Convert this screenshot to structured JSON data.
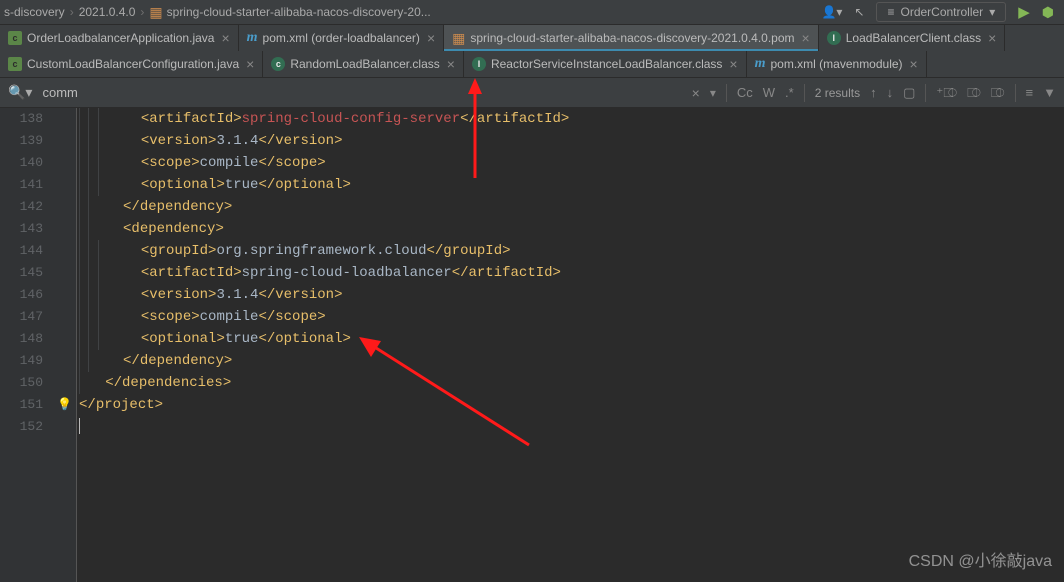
{
  "breadcrumb": {
    "b1": "s-discovery",
    "b2": "2021.0.4.0",
    "b3": "spring-cloud-starter-alibaba-nacos-discovery-20..."
  },
  "run_config": "OrderController",
  "tabs": {
    "t1": "OrderLoadbalancerApplication.java",
    "t2": "pom.xml (order-loadbalancer)",
    "t3": "spring-cloud-starter-alibaba-nacos-discovery-2021.0.4.0.pom",
    "t4": "LoadBalancerClient.class",
    "t5": "CustomLoadBalancerConfiguration.java",
    "t6": "RandomLoadBalancer.class",
    "t7": "ReactorServiceInstanceLoadBalancer.class",
    "t8": "pom.xml (mavenmodule)"
  },
  "find": {
    "text": "comm",
    "results": "2 results",
    "cc": "Cc",
    "w": "W",
    "star": ".*"
  },
  "ln": {
    "l138": "138",
    "l139": "139",
    "l140": "140",
    "l141": "141",
    "l142": "142",
    "l143": "143",
    "l144": "144",
    "l145": "145",
    "l146": "146",
    "l147": "147",
    "l148": "148",
    "l149": "149",
    "l150": "150",
    "l151": "151",
    "l152": "152"
  },
  "code": {
    "artifactId_o": "<artifactId>",
    "artifactId_c": "</artifactId>",
    "version_o": "<version>",
    "version_c": "</version>",
    "scope_o": "<scope>",
    "scope_c": "</scope>",
    "optional_o": "<optional>",
    "optional_c": "</optional>",
    "dep_o": "<dependency>",
    "dep_c": "</dependency>",
    "deps_c": "</dependencies>",
    "group_o": "<groupId>",
    "group_c": "</groupId>",
    "proj": "project>",
    "v_configserver": "spring-cloud-config-server",
    "v_version": "3.1.4",
    "v_scope": "compile",
    "v_true": "true",
    "v_group": "org.springframework.cloud",
    "v_lb": "spring-cloud-loadbalancer"
  },
  "watermark": "CSDN @小徐敲java"
}
